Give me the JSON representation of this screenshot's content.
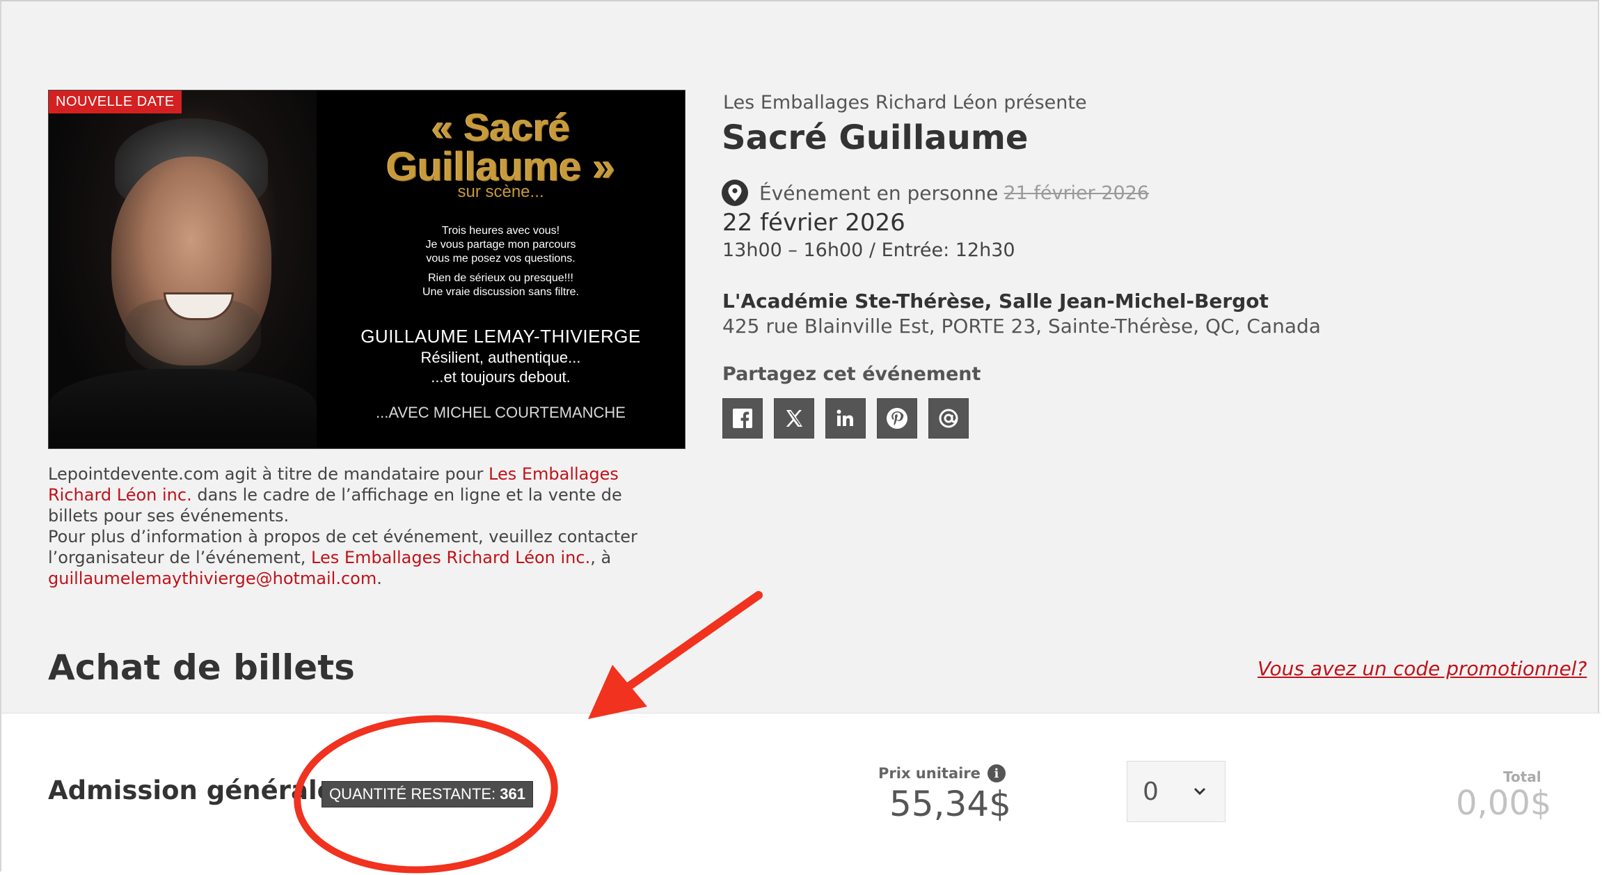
{
  "poster": {
    "badge": "NOUVELLE DATE",
    "title_line1": "« Sacré",
    "title_line2": "Guillaume »",
    "title_line3": "sur scène...",
    "blurb_1": "Trois heures avec vous!",
    "blurb_2": "Je vous partage mon parcours",
    "blurb_3": "vous me posez vos questions.",
    "blurb_4": "Rien de sérieux ou presque!!!",
    "blurb_5": "Une vraie discussion sans filtre.",
    "artist": "GUILLAUME LEMAY-THIVIERGE",
    "tagline_1": "Résilient, authentique...",
    "tagline_2": "...et toujours debout.",
    "with": "...AVEC MICHEL COURTEMANCHE"
  },
  "event": {
    "presenter": "Les Emballages Richard Léon présente",
    "title": "Sacré Guillaume",
    "type": "Événement en personne",
    "old_date": "21 février 2026",
    "date": "22 février 2026",
    "time": "13h00 – 16h00 / Entrée: 12h30",
    "venue": "L'Académie Ste-Thérèse, Salle Jean-Michel-Bergot",
    "address": "425 rue Blainville Est, PORTE 23, Sainte-Thérèse, QC, Canada",
    "share_label": "Partagez cet événement",
    "share_icons": [
      "facebook-icon",
      "x-icon",
      "linkedin-icon",
      "pinterest-icon",
      "email-icon"
    ]
  },
  "disclaimer": {
    "p1_a": "Lepointdevente.com agit à titre de mandataire pour ",
    "p1_link": "Les Emballages Richard Léon inc.",
    "p1_b": " dans le cadre de l’affichage en ligne et la vente de billets pour ses événements.",
    "p2_a": "Pour plus d’information à propos de cet événement, veuillez contacter l’organisateur de l’événement, ",
    "p2_link": "Les Emballages Richard Léon inc.",
    "p2_b": ", à ",
    "email": "guillaumelemaythivierge@hotmail.com",
    "p2_c": "."
  },
  "tickets": {
    "section_title": "Achat de billets",
    "promo_link": "Vous avez un code promotionnel?",
    "name": "Admission générale",
    "qty_label": "QUANTITÉ RESTANTE:",
    "qty_value": "361",
    "price_label": "Prix unitaire",
    "price": "55,34$",
    "quantity_selected": "0",
    "total_label": "Total",
    "total": "0,00$"
  },
  "colors": {
    "accent_red": "#c0121a",
    "badge_red": "#d42020",
    "annotation_red": "#f0321e",
    "page_bg": "#f2f2f2"
  }
}
